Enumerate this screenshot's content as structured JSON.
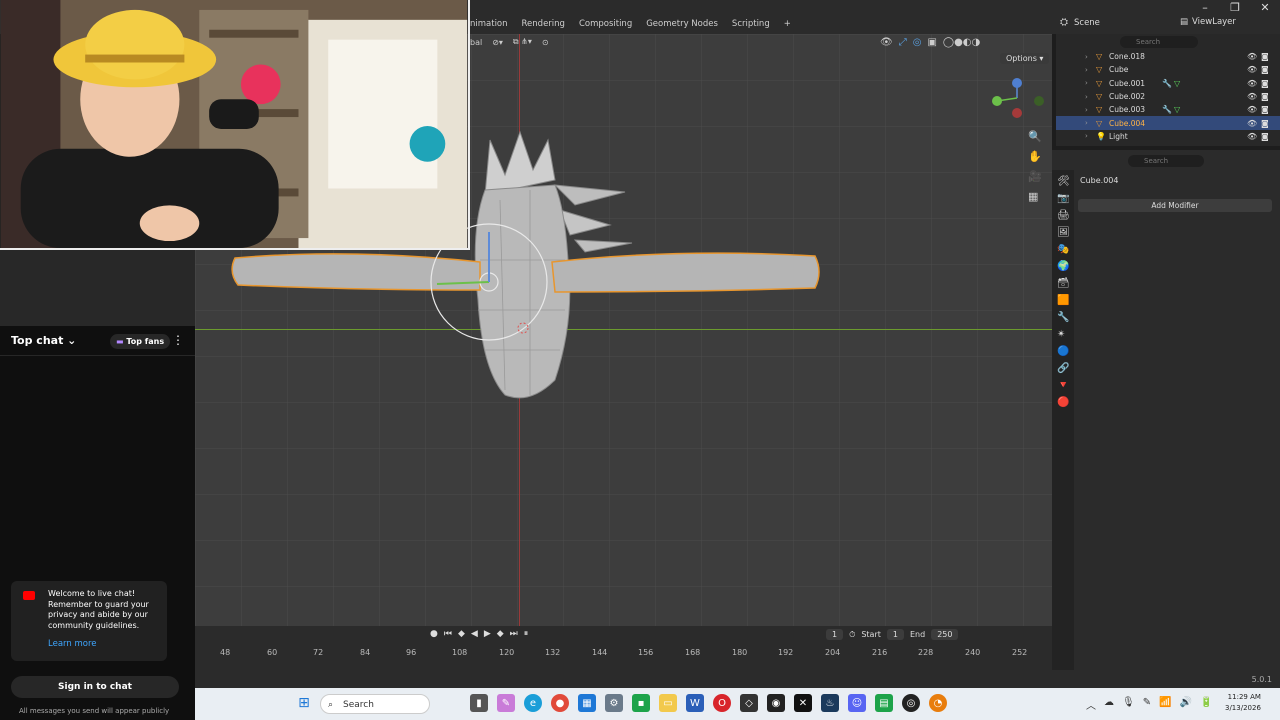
{
  "window": {
    "controls": [
      "–",
      "❐",
      "✕"
    ]
  },
  "blender": {
    "workspace_tabs": [
      "nimation",
      "Rendering",
      "Compositing",
      "Geometry Nodes",
      "Scripting",
      "+"
    ],
    "scene_label": "Scene",
    "view_layer_label": "ViewLayer",
    "viewport": {
      "transform_orientation": "bal",
      "options_label": "Options"
    },
    "outliner": {
      "search_placeholder": "Search",
      "items": [
        {
          "name": "Cone.018",
          "active": false
        },
        {
          "name": "Cube",
          "active": false
        },
        {
          "name": "Cube.001",
          "active": false
        },
        {
          "name": "Cube.002",
          "active": false
        },
        {
          "name": "Cube.003",
          "active": false
        },
        {
          "name": "Cube.004",
          "active": true
        },
        {
          "name": "Light",
          "active": false
        }
      ]
    },
    "properties": {
      "search_placeholder": "Search",
      "object_name": "Cube.004",
      "add_modifier_label": "Add Modifier"
    },
    "timeline": {
      "current_frame": "1",
      "start_label": "Start",
      "start_value": "1",
      "end_label": "End",
      "end_value": "250",
      "ruler_ticks": [
        "48",
        "60",
        "72",
        "84",
        "96",
        "108",
        "120",
        "132",
        "144",
        "156",
        "168",
        "180",
        "192",
        "204",
        "216",
        "228",
        "240",
        "252"
      ]
    },
    "version": "5.0.1"
  },
  "chat": {
    "title": "Top chat",
    "filter_label": "Top fans",
    "welcome_text": "Welcome to live chat! Remember to guard your privacy and abide by our community guidelines.",
    "learn_more": "Learn more",
    "sign_in": "Sign in to chat",
    "notice": "All messages you send will appear publicly"
  },
  "taskbar": {
    "search_label": "Search",
    "time": "11:29 AM",
    "date": "3/13/2026"
  }
}
